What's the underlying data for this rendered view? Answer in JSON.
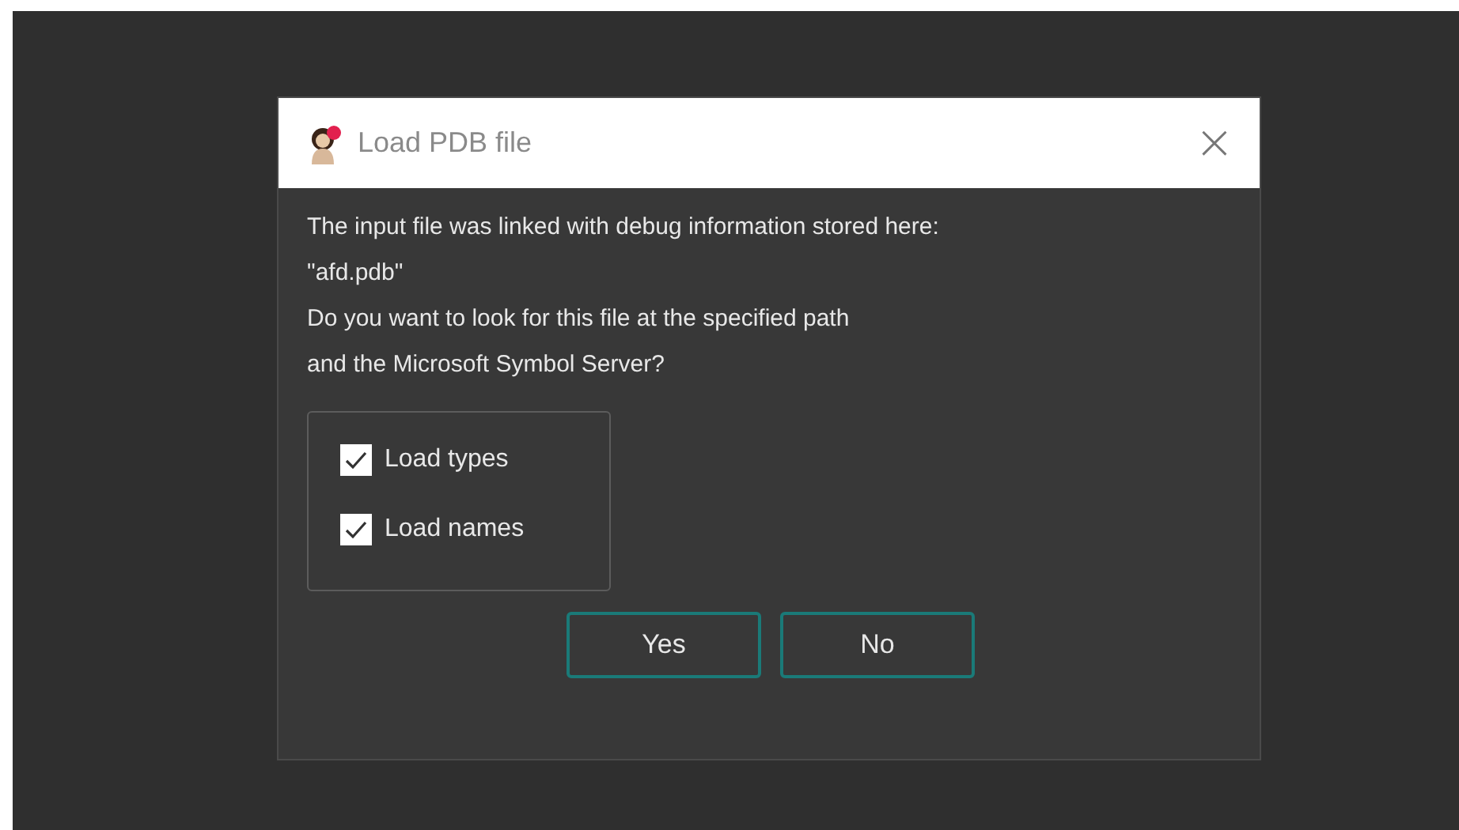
{
  "window": {
    "title": "Load PDB file",
    "close": "×"
  },
  "message": [
    "The input file was linked with debug information stored here:",
    "\"afd.pdb\"",
    "Do you want to look for this file at the specified path",
    "and the Microsoft Symbol Server?"
  ],
  "options": [
    {
      "label": "Load types",
      "checked": true
    },
    {
      "label": "Load names",
      "checked": true
    }
  ],
  "buttons": [
    "Yes",
    "No"
  ]
}
